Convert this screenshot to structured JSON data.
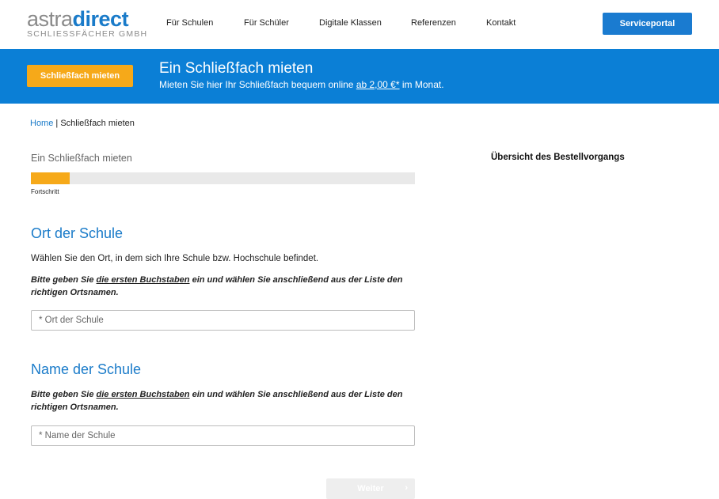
{
  "header": {
    "logo": {
      "part1": "astra",
      "part2": "direct",
      "subtitle": "SCHLIESSFÄCHER GMBH"
    },
    "nav": [
      "Für Schulen",
      "Für Schüler",
      "Digitale Klassen",
      "Referenzen",
      "Kontakt"
    ],
    "service_button": "Serviceportal"
  },
  "banner": {
    "button": "Schließfach mieten",
    "title": "Ein Schließfach mieten",
    "sub_before": "Mieten Sie hier Ihr Schließfach bequem online ",
    "sub_link": "ab 2,00 €*",
    "sub_after": " im Monat."
  },
  "breadcrumb": {
    "home": "Home",
    "separator": " | ",
    "current": "Schließfach mieten"
  },
  "main": {
    "step_title": "Ein Schließfach mieten",
    "progress_label": "Fortschritt",
    "progress": 0.1,
    "section1": {
      "title": "Ort der Schule",
      "intro": "Wählen Sie den Ort, in dem sich Ihre Schule bzw. Hochschule befindet.",
      "hint_before": "Bitte geben Sie ",
      "hint_link": "die ersten Buchstaben",
      "hint_after": " ein und wählen Sie anschließend aus der Liste den richtigen Ortsnamen.",
      "placeholder": "* Ort der Schule"
    },
    "section2": {
      "title": "Name der Schule",
      "hint_before": "Bitte geben Sie ",
      "hint_link": "die ersten Buchstaben",
      "hint_after": " ein und wählen Sie anschließend aus der Liste den richtigen Ortsnamen.",
      "placeholder": "* Name der Schule"
    },
    "next_button": "Weiter",
    "next_icon": "chevron-right-icon"
  },
  "sidebar": {
    "title": "Übersicht des Bestellvorgangs"
  },
  "colors": {
    "brand_blue": "#0b7fd6",
    "accent_orange": "#f6a919",
    "progress_bg": "#e9e9e9"
  }
}
